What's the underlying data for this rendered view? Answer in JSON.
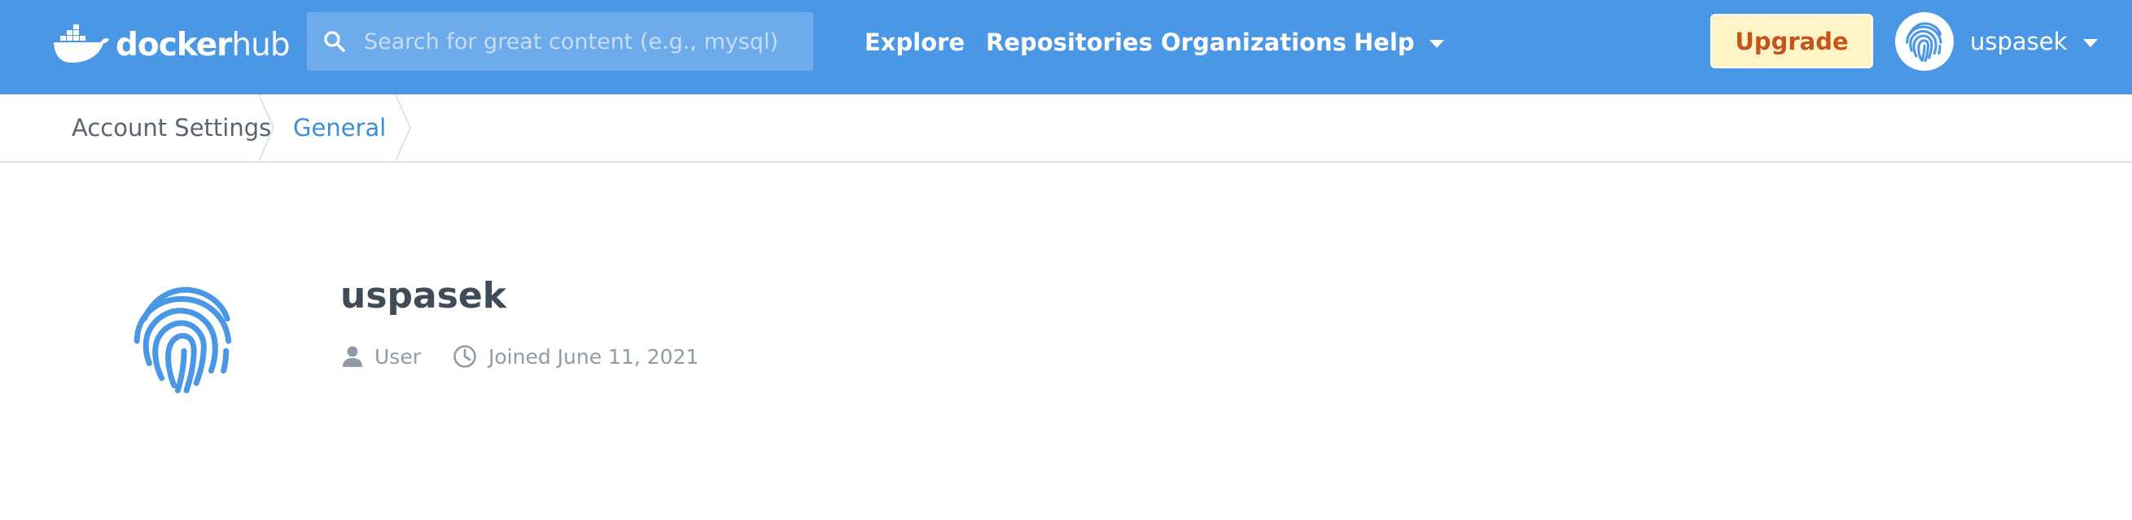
{
  "navbar": {
    "background": "#4a97e6",
    "logo": {
      "part1": "docker",
      "part2": "hub",
      "icon": "docker-whale-icon"
    },
    "search": {
      "placeholder": "Search for great content (e.g., mysql)",
      "value": "",
      "icon": "search-icon"
    },
    "links": [
      {
        "label": "Explore"
      },
      {
        "label": "Repositories"
      },
      {
        "label": "Organizations"
      },
      {
        "label": "Help",
        "icon": "chevron-down-icon"
      }
    ],
    "upgrade_label": "Upgrade",
    "upgrade_colors": {
      "background": "#fff4c8",
      "text": "#c4541a"
    },
    "user": {
      "name": "uspasek",
      "avatar_icon": "fingerprint-icon",
      "caret_icon": "chevron-down-icon"
    }
  },
  "breadcrumb": {
    "items": [
      {
        "label": "Account Settings",
        "color": "#5a6570"
      },
      {
        "label": "General",
        "color": "#3a8fd9"
      }
    ]
  },
  "profile": {
    "username": "uspasek",
    "avatar_icon": "fingerprint-icon",
    "avatar_color": "#4a97e6",
    "type_label": "User",
    "type_icon": "user-icon",
    "joined_label": "Joined June 11, 2021",
    "joined_icon": "clock-icon"
  }
}
